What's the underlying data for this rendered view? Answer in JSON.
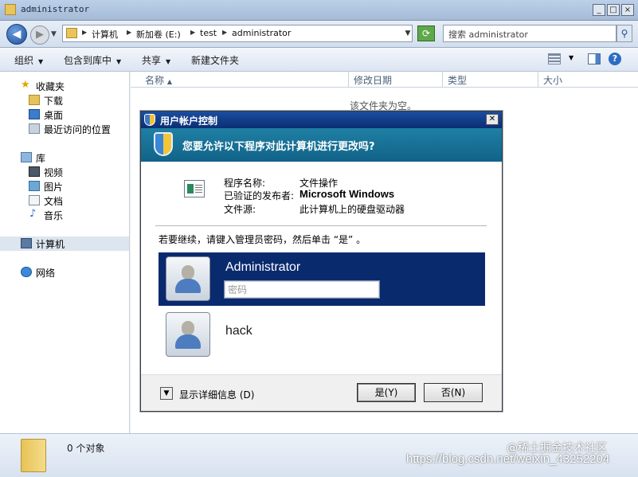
{
  "explorer": {
    "window_title": "administrator",
    "window_buttons": {
      "minimize": "_",
      "maximize": "□",
      "close": "×"
    },
    "address": {
      "crumbs": [
        "计算机",
        "新加卷 (E:)",
        "test",
        "administrator"
      ]
    },
    "search": {
      "placeholder": "搜索 administrator"
    },
    "toolbar": {
      "organize": "组织",
      "include_library": "包含到库中",
      "share": "共享",
      "new_folder": "新建文件夹"
    },
    "nav": {
      "favorites": {
        "label": "收藏夹",
        "items": [
          "下载",
          "桌面",
          "最近访问的位置"
        ]
      },
      "libraries": {
        "label": "库",
        "items": [
          "视频",
          "图片",
          "文档",
          "音乐"
        ]
      },
      "computer": "计算机",
      "network": "网络"
    },
    "columns": [
      "名称",
      "修改日期",
      "类型",
      "大小"
    ],
    "empty_message": "该文件夹为空。",
    "details": {
      "count_text": "0 个对象"
    }
  },
  "uac": {
    "title": "用户帐户控制",
    "question": "您要允许以下程序对此计算机进行更改吗?",
    "info": [
      {
        "label": "程序名称:",
        "value": "文件操作"
      },
      {
        "label": "已验证的发布者:",
        "value": "Microsoft Windows"
      },
      {
        "label": "文件源:",
        "value": "此计算机上的硬盘驱动器"
      }
    ],
    "instruction": "若要继续，请键入管理员密码，然后单击 “是” 。",
    "accounts": [
      {
        "name": "Administrator",
        "password_placeholder": "密码",
        "selected": true
      },
      {
        "name": "hack",
        "selected": false
      }
    ],
    "show_details": "显示详细信息 (D)",
    "buttons": {
      "yes": "是(Y)",
      "no": "否(N)"
    },
    "colors": {
      "title_bar": "#0a2e74",
      "banner": "#116388",
      "selected_tile": "#0a2a6e"
    }
  },
  "watermark": {
    "line1": "@稀土掘金技术社区",
    "line2": "https://blog.csdn.net/weixin_43252204"
  }
}
